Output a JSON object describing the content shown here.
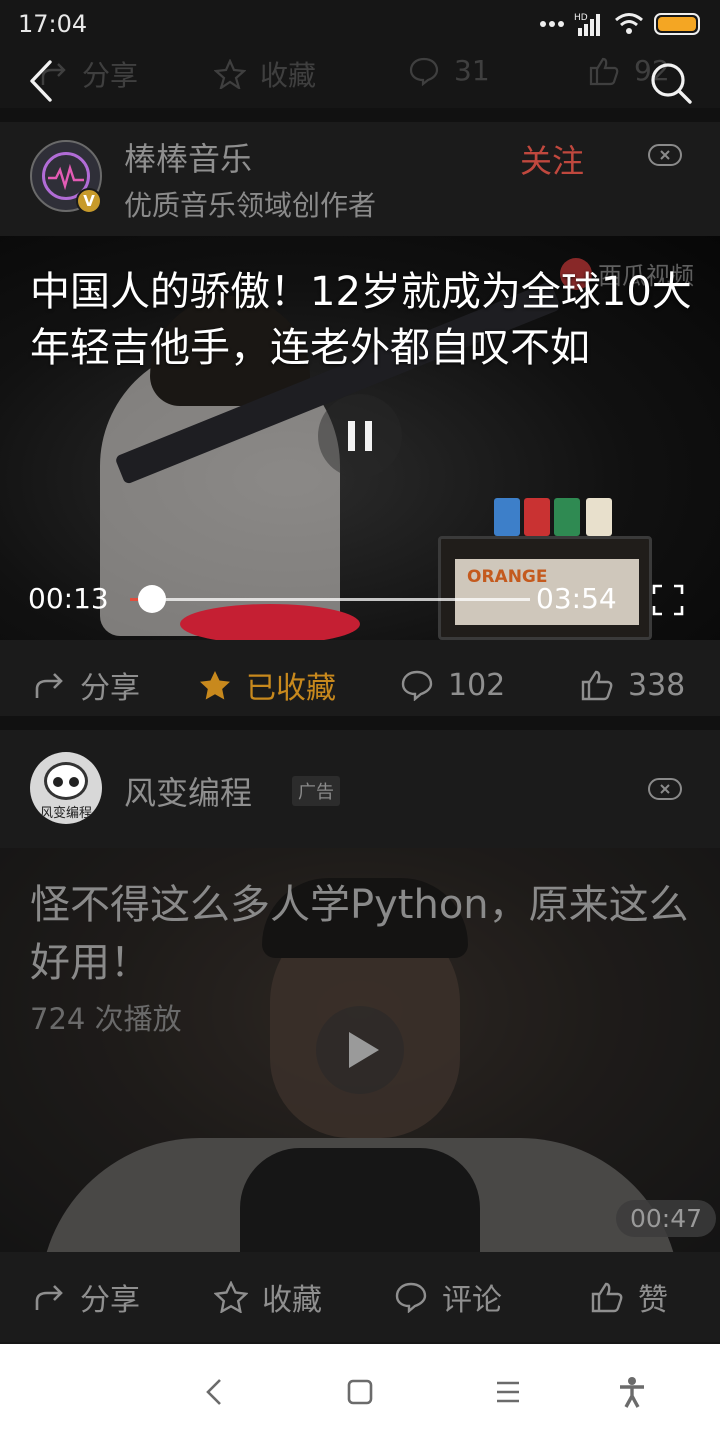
{
  "status_bar": {
    "time": "17:04",
    "network": "HD",
    "icons": [
      "signal-dots-icon",
      "hd-icon",
      "cellular-signal-icon",
      "wifi-icon",
      "battery-icon"
    ],
    "battery_color": "#f4a623"
  },
  "top_bar": {
    "ghost_actions": [
      {
        "icon": "share-icon",
        "label": "分享"
      },
      {
        "icon": "star-icon",
        "label": "收藏"
      },
      {
        "icon": "comment-icon",
        "label": "31"
      },
      {
        "icon": "thumbs-up-icon",
        "label": "92"
      }
    ]
  },
  "post1": {
    "author": "棒棒音乐",
    "author_desc": "优质音乐领域创作者",
    "verified_badge": "V",
    "follow_label": "关注",
    "follow_color": "#c0483e",
    "video": {
      "title": "中国人的骄傲！12岁就成为全球10大年轻吉他手，连老外都自叹不如",
      "watermark": "西瓜视频",
      "amp_brand": "ORANGE",
      "current_time": "00:13",
      "total_time": "03:54",
      "progress_fraction": 0.056,
      "state": "playing"
    },
    "actions": {
      "share": "分享",
      "favorite": "已收藏",
      "comments": "102",
      "likes": "338"
    },
    "favorite_color": "#c8891d"
  },
  "post2": {
    "author": "风变编程",
    "avatar_text": "风变编程",
    "ad_tag": "广告",
    "video": {
      "title": "怪不得这么多人学Python，原来这么好用！",
      "play_count": "724 次播放",
      "duration": "00:47"
    },
    "actions": {
      "share": "分享",
      "favorite": "收藏",
      "comment": "评论",
      "like": "赞"
    }
  },
  "nav_bar": {
    "icons": [
      "back-nav-icon",
      "home-square-icon",
      "menu-lines-icon",
      "accessibility-icon"
    ]
  }
}
